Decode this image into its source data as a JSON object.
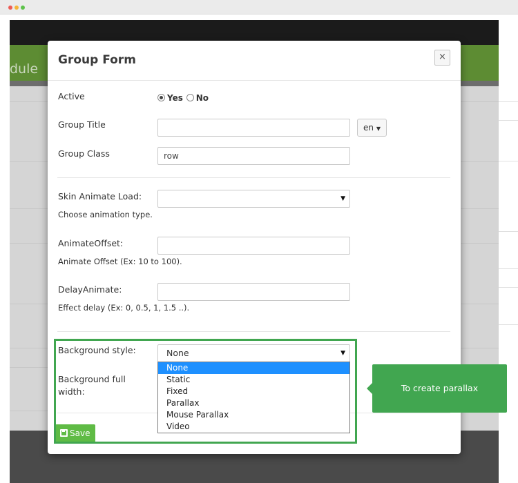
{
  "background_page": {
    "module_title_partial": "dule"
  },
  "modal": {
    "title": "Group Form",
    "close_label": "×",
    "active": {
      "label": "Active",
      "options": [
        "Yes",
        "No"
      ],
      "selected": "Yes"
    },
    "group_title": {
      "label": "Group Title",
      "value": "",
      "language": "en"
    },
    "group_class": {
      "label": "Group Class",
      "value": "row"
    },
    "skin_animate": {
      "label": "Skin Animate Load:",
      "value": "",
      "help": "Choose animation type."
    },
    "animate_offset": {
      "label": "AnimateOffset:",
      "value": "",
      "help": "Animate Offset (Ex: 10 to 100)."
    },
    "delay_animate": {
      "label": "DelayAnimate:",
      "value": "",
      "help": "Effect delay (Ex: 0, 0.5, 1, 1.5 ..)."
    },
    "background_style": {
      "label": "Background style:",
      "value": "None",
      "options": [
        "None",
        "Static",
        "Fixed",
        "Parallax",
        "Mouse Parallax",
        "Video"
      ],
      "highlighted_option": "None"
    },
    "background_full_width": {
      "label_line1": "Background full",
      "label_line2": "width:"
    },
    "save_label": "Save"
  },
  "callout": {
    "text": "To create parallax"
  },
  "colors": {
    "accent_green": "#41a650",
    "save_green": "#5fbb45",
    "selected_option_blue": "#1e90ff"
  }
}
